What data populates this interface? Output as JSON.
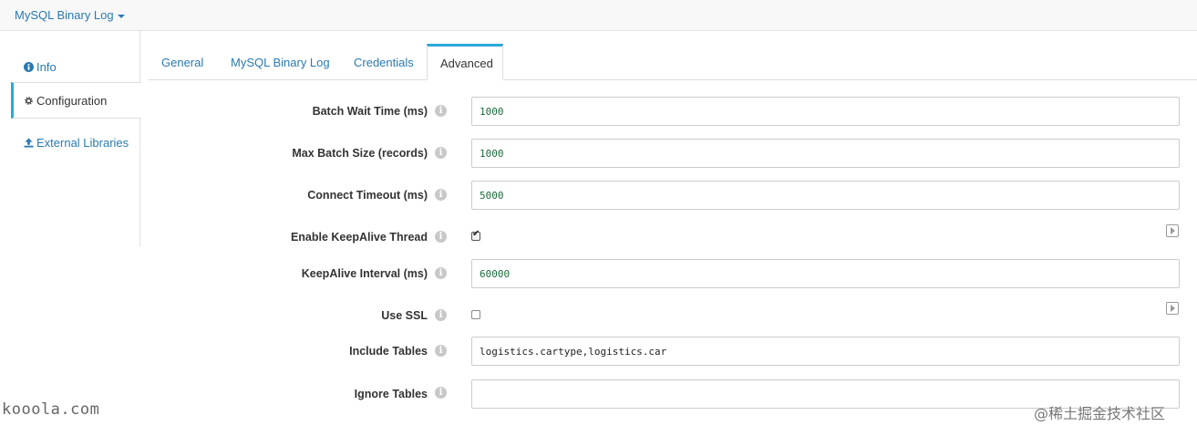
{
  "header": {
    "stage_title": "MySQL Binary Log"
  },
  "sidebar": {
    "items": [
      {
        "label": "Info",
        "icon": "info-icon"
      },
      {
        "label": "Configuration",
        "icon": "gear-icon",
        "active": true
      },
      {
        "label": "External Libraries",
        "icon": "upload-icon"
      }
    ]
  },
  "tabs": [
    {
      "label": "General"
    },
    {
      "label": "MySQL Binary Log"
    },
    {
      "label": "Credentials"
    },
    {
      "label": "Advanced",
      "active": true
    }
  ],
  "form": {
    "batch_wait_time": {
      "label": "Batch Wait Time (ms)",
      "value": "1000"
    },
    "max_batch_size": {
      "label": "Max Batch Size (records)",
      "value": "1000"
    },
    "connect_timeout": {
      "label": "Connect Timeout (ms)",
      "value": "5000"
    },
    "enable_keepalive": {
      "label": "Enable KeepAlive Thread",
      "checked": true
    },
    "keepalive_interval": {
      "label": "KeepAlive Interval (ms)",
      "value": "60000"
    },
    "use_ssl": {
      "label": "Use SSL",
      "checked": false
    },
    "include_tables": {
      "label": "Include Tables",
      "value": "logistics.cartype,logistics.car"
    },
    "ignore_tables": {
      "label": "Ignore Tables",
      "value": ""
    }
  },
  "watermarks": {
    "left": "kooola.com",
    "right": "@稀土掘金技术社区"
  },
  "colors": {
    "accent": "#2aa9d8",
    "link": "#2a7ab0",
    "value_text": "#1c6b3c"
  }
}
